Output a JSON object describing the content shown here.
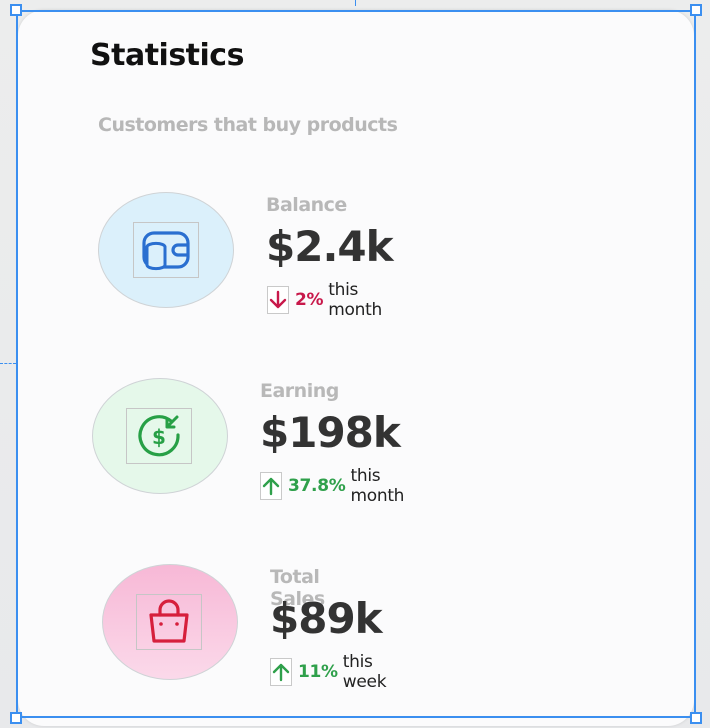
{
  "card": {
    "title": "Statistics",
    "subtitle": "Customers that buy products"
  },
  "stats": [
    {
      "label": "Balance",
      "value": "$2.4k",
      "change": "2%",
      "period": "this month",
      "direction": "down",
      "icon": "wallet-coins-icon",
      "circle_color": "#dbf0fb",
      "icon_color": "#2a6fd0"
    },
    {
      "label": "Earning",
      "value": "$198k",
      "change": "37.8%",
      "period": "this month",
      "direction": "up",
      "icon": "dollar-refresh-icon",
      "circle_color": "#e5f8ea",
      "icon_color": "#27a046"
    },
    {
      "label": "Total Sales",
      "value": "$89k",
      "change": "11%",
      "period": "this week",
      "direction": "up",
      "icon": "shopping-bag-icon",
      "circle_color": "#f9c4dd",
      "icon_color": "#d61f3c"
    }
  ],
  "colors": {
    "selection": "#3b8ff0",
    "down": "#c8184a",
    "up": "#2fa04b"
  }
}
